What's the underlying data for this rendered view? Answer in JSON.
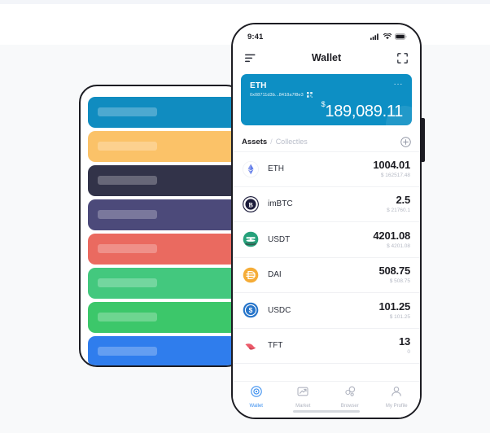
{
  "scene": {
    "background_top": "#f3f5f9",
    "background": "#f8f9fa"
  },
  "back_phone": {
    "name": "token-card-list-preview",
    "cards": [
      {
        "label": "",
        "color": "#108cc0",
        "icon": "ethereum-icon",
        "glyph": "♦"
      },
      {
        "label": "",
        "color": "#fbc268",
        "icon": "bitcoin-icon",
        "glyph": "B"
      },
      {
        "label": "",
        "color": "#323349",
        "icon": "atom-icon",
        "glyph": "⚛"
      },
      {
        "label": "",
        "color": "#4c4a7a",
        "icon": "eos-icon",
        "glyph": "◈"
      },
      {
        "label": "",
        "color": "#ea6a60",
        "icon": "tron-icon",
        "glyph": "▷"
      },
      {
        "label": "",
        "color": "#43c87e",
        "icon": "neo-icon",
        "glyph": "N"
      },
      {
        "label": "",
        "color": "#3cc76a",
        "icon": "bitcoin-cash-icon",
        "glyph": "B"
      },
      {
        "label": "",
        "color": "#2f7ded",
        "icon": "litecoin-icon",
        "glyph": "L"
      }
    ]
  },
  "phone": {
    "status_bar": {
      "time": "9:41",
      "cellular_icon": "signal-bars-icon",
      "wifi_icon": "wifi-icon",
      "battery_icon": "battery-icon"
    },
    "nav": {
      "menu_icon": "hamburger-menu-icon",
      "title": "Wallet",
      "scan_icon": "scan-qr-icon"
    },
    "balance_card": {
      "symbol": "ETH",
      "address": "0x08711d3b...8418a7f8e3",
      "copy_icon": "qr-code-icon",
      "more_icon": "more-options-icon",
      "more_label": "···",
      "currency": "$",
      "amount": "189,089.11",
      "accent": "#0d8fc4"
    },
    "tabs": {
      "active": "Assets",
      "separator": "/",
      "inactive": "Collectles",
      "add_icon": "add-asset-icon"
    },
    "assets": [
      {
        "name": "ETH",
        "amount": "1004.01",
        "fiat": "$ 162517.48",
        "icon": "ethereum-icon",
        "color": "#627eea"
      },
      {
        "name": "imBTC",
        "amount": "2.5",
        "fiat": "$ 21760.1",
        "icon": "imbtc-icon",
        "color": "#1b1b3a"
      },
      {
        "name": "USDT",
        "amount": "4201.08",
        "fiat": "$ 4201.08",
        "icon": "tether-icon",
        "color": "#26a17b"
      },
      {
        "name": "DAI",
        "amount": "508.75",
        "fiat": "$ 508.75",
        "icon": "dai-icon",
        "color": "#f5ac37"
      },
      {
        "name": "USDC",
        "amount": "101.25",
        "fiat": "$ 101.25",
        "icon": "usdc-icon",
        "color": "#2775ca"
      },
      {
        "name": "TFT",
        "amount": "13",
        "fiat": "0",
        "icon": "tft-icon",
        "color": "#ec5a6a"
      }
    ],
    "tabbar": [
      {
        "label": "Wallet",
        "icon": "wallet-icon",
        "active": true
      },
      {
        "label": "Market",
        "icon": "market-icon",
        "active": false
      },
      {
        "label": "Browser",
        "icon": "browser-icon",
        "active": false
      },
      {
        "label": "My Profile",
        "icon": "profile-icon",
        "active": false
      }
    ]
  }
}
